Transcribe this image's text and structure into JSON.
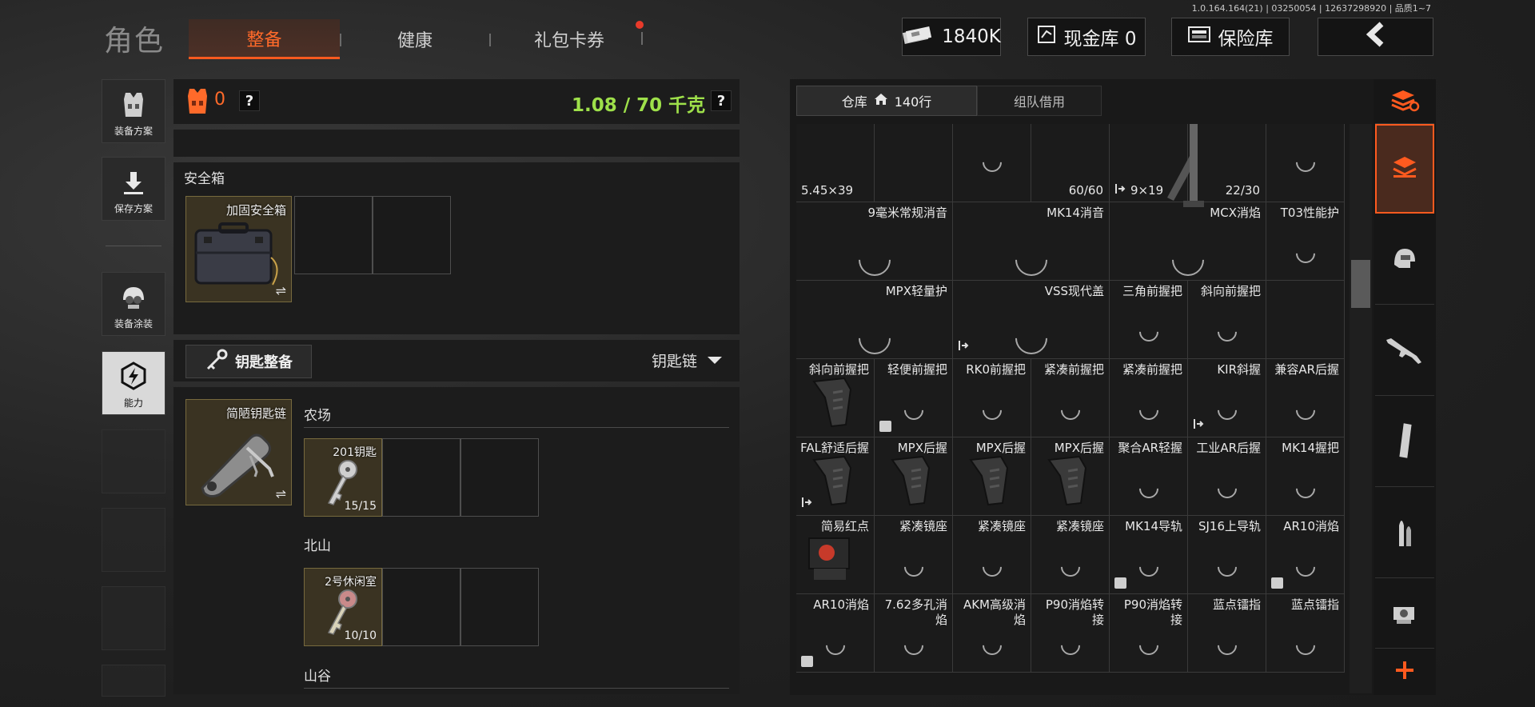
{
  "version": "1.0.164.164(21) | 03250054 | 12637298920 | 品质1~7",
  "header": {
    "role": "角色",
    "tabs": [
      {
        "label": "整备",
        "active": true
      },
      {
        "label": "健康",
        "active": false
      },
      {
        "label": "礼包卡券",
        "active": false,
        "dot": true
      }
    ],
    "money": "1840K",
    "cash_vault": "现金库 0",
    "safe_vault": "保险库",
    "back": "back"
  },
  "sidebar": [
    {
      "label": "装备方案",
      "icon": "vest-icon"
    },
    {
      "label": "保存方案",
      "icon": "download-icon"
    },
    {
      "label": "装备涂装",
      "icon": "helmet-icon"
    },
    {
      "label": "能力",
      "icon": "ability-icon",
      "active": true
    }
  ],
  "equip": {
    "armor_count": "0",
    "help": "?",
    "weight": "1.08 / 70 千克",
    "safebox_label": "安全箱",
    "safebox_item": "加固安全箱",
    "swap": "⇌",
    "key_button": "钥匙整备",
    "key_dropdown": "钥匙链",
    "keychain_item": "简陋钥匙链",
    "key_groups": [
      {
        "title": "农场",
        "key_name": "201钥匙",
        "count": "15/15"
      },
      {
        "title": "北山",
        "key_name": "2号休闲室",
        "count": "10/10"
      },
      {
        "title": "山谷"
      }
    ]
  },
  "warehouse": {
    "tab_storage": "仓库",
    "rows": "140行",
    "tab_team": "组队借用",
    "cells": [
      [
        {
          "cal": "5.45×39"
        },
        {},
        {
          "spin": 1
        },
        {
          "cnt": "60/60"
        },
        {
          "flag": 1,
          "cal": "9×19"
        },
        {
          "cnt": "22/30"
        },
        {
          "spin": 1
        }
      ],
      [
        {
          "name": "9毫米常规消音",
          "span": 2
        },
        {
          "name": "MK14消音",
          "span": 2
        },
        {
          "name": "MCX消焰",
          "span": 2
        },
        {
          "name": "T03性能护"
        }
      ],
      [
        {
          "name": "MPX轻量护",
          "span": 2
        },
        {
          "name": "VSS现代盖",
          "span": 2,
          "flag": 1
        },
        {
          "name": "三角前握把"
        },
        {
          "name": "斜向前握把"
        },
        {}
      ],
      [
        {
          "name": "斜向前握把",
          "pic": "grip"
        },
        {
          "name": "轻便前握把",
          "box": 1
        },
        {
          "name": "RK0前握把"
        },
        {
          "name": "紧凑前握把"
        },
        {
          "name": "紧凑前握把"
        },
        {
          "name": "KIR斜握",
          "flag": 1
        },
        {
          "name": "兼容AR后握"
        }
      ],
      [
        {
          "name": "FAL舒适后握",
          "flag": 1,
          "pic": "grip"
        },
        {
          "name": "MPX后握",
          "pic": "grip"
        },
        {
          "name": "MPX后握",
          "pic": "grip"
        },
        {
          "name": "MPX后握",
          "pic": "grip"
        },
        {
          "name": "聚合AR轻握"
        },
        {
          "name": "工业AR后握"
        },
        {
          "name": "MK14握把"
        }
      ],
      [
        {
          "name": "简易红点",
          "pic": "dot"
        },
        {
          "name": "紧凑镜座"
        },
        {
          "name": "紧凑镜座"
        },
        {
          "name": "紧凑镜座"
        },
        {
          "name": "MK14导轨",
          "box": 1
        },
        {
          "name": "SJ16上导轨"
        },
        {
          "name": "AR10消焰",
          "box": 1
        }
      ],
      [
        {
          "name": "AR10消焰",
          "box": 1
        },
        {
          "name": "7.62多孔消焰"
        },
        {
          "name": "AKM高级消焰"
        },
        {
          "name": "P90消焰转接"
        },
        {
          "name": "P90消焰转接"
        },
        {
          "name": "蓝点镭指"
        },
        {
          "name": "蓝点镭指"
        }
      ]
    ]
  },
  "right_tabs": [
    "stack-icon",
    "layers-icon",
    "vest-icon",
    "rifle-icon",
    "magazine-icon",
    "bullet-icon",
    "sight-icon",
    "plus-icon"
  ],
  "colors": {
    "accent": "#ff5a1f",
    "weight": "#9ee04a"
  }
}
